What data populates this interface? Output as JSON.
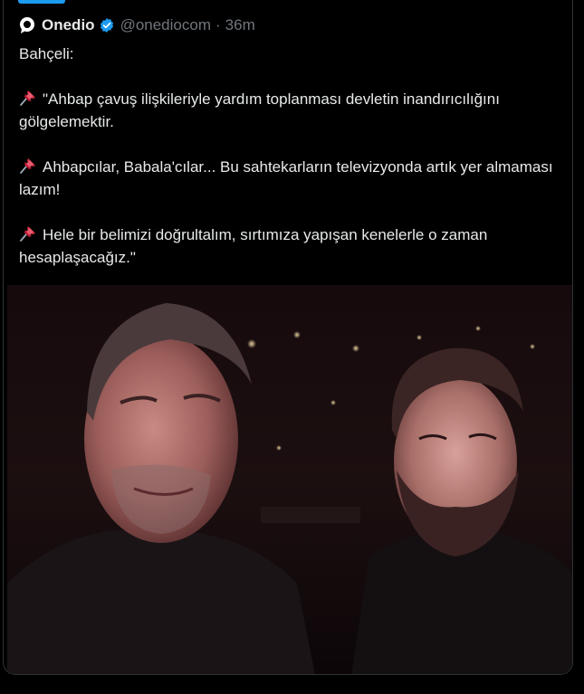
{
  "tweet": {
    "author_name": "Onedio",
    "handle": "@onediocom",
    "separator": "·",
    "time": "36m",
    "intro": "Bahçeli:",
    "quotes": [
      "\"Ahbap çavuş ilişkileriyle yardım toplanması devletin inandırıcılığını gölgelemektir.",
      "Ahbapcılar, Babala'cılar... Bu sahtekarların televizyonda artık yer almaması lazım!",
      "Hele bir belimizi doğrultalım, sırtımıza yapışan kenelerle o zaman hesaplaşacağız.\""
    ]
  },
  "icons": {
    "logo": "onedio-logo-icon",
    "verified": "verified-badge-icon",
    "pin": "pushpin-emoji-icon"
  },
  "colors": {
    "background": "#000000",
    "text": "#e7e9ea",
    "muted": "#71767b",
    "verified": "#1d9bf0",
    "pin": "#e0245e"
  }
}
